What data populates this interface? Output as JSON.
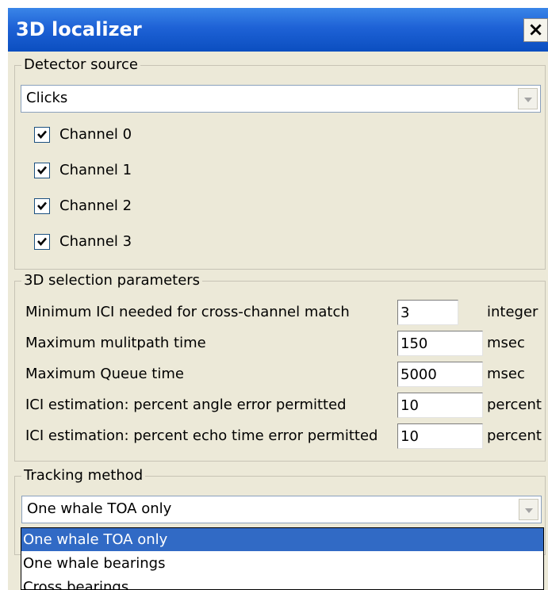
{
  "window": {
    "title": "3D localizer",
    "close_label": "×"
  },
  "detector_source": {
    "legend": "Detector source",
    "selected": "Clicks",
    "channels": [
      {
        "label": "Channel 0",
        "checked": true
      },
      {
        "label": "Channel 1",
        "checked": true
      },
      {
        "label": "Channel 2",
        "checked": true
      },
      {
        "label": "Channel 3",
        "checked": true
      }
    ]
  },
  "selection_params": {
    "legend": "3D selection parameters",
    "rows": [
      {
        "label": "Minimum ICI needed for cross-channel match",
        "value": "3",
        "unit": "integer"
      },
      {
        "label": "Maximum mulitpath time",
        "value": "150",
        "unit": "msec"
      },
      {
        "label": "Maximum Queue time",
        "value": "5000",
        "unit": "msec"
      },
      {
        "label": "ICI estimation: percent angle error permitted",
        "value": "10",
        "unit": "percent"
      },
      {
        "label": "ICI estimation: percent echo time error permitted",
        "value": "10",
        "unit": "percent"
      }
    ]
  },
  "tracking": {
    "legend": "Tracking method",
    "selected": "One whale TOA only",
    "options": [
      "One whale TOA only",
      "One whale bearings",
      "Cross bearings"
    ]
  }
}
